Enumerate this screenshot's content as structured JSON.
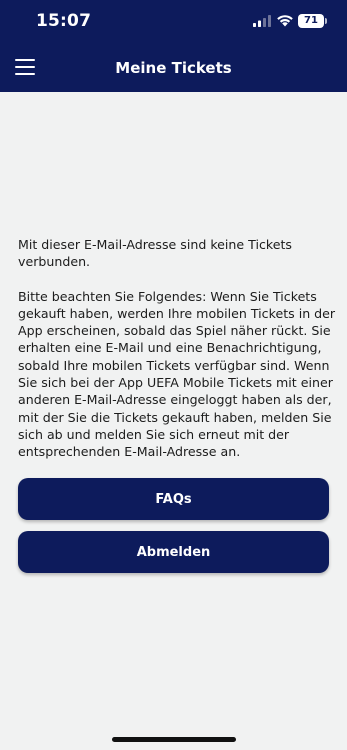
{
  "status_bar": {
    "time": "15:07",
    "battery_level": "71",
    "icons": [
      "signal-icon",
      "wifi-icon",
      "battery-icon"
    ]
  },
  "header": {
    "title": "Meine Tickets",
    "menu_icon": "hamburger-menu-icon"
  },
  "message": {
    "paragraph_1": "Mit dieser E-Mail-Adresse sind keine Tickets verbunden.",
    "paragraph_2": "Bitte beachten Sie Folgendes: Wenn Sie Tickets gekauft haben, werden Ihre mobilen Tickets in der App erscheinen, sobald das Spiel näher rückt. Sie erhalten eine E-Mail und eine Benachrichtigung, sobald Ihre mobilen Tickets verfügbar sind. Wenn Sie sich bei der App UEFA Mobile Tickets mit einer anderen E-Mail-Adresse eingeloggt haben als der, mit der Sie die Tickets gekauft haben, melden Sie sich ab und melden Sie sich erneut mit der entsprechenden E-Mail-Adresse an."
  },
  "actions": {
    "faq_label": "FAQs",
    "logout_label": "Abmelden"
  },
  "colors": {
    "header_background": "#0d1b5c",
    "button_background": "#0d1b5c",
    "page_background": "#f1f2f2",
    "text": "#1c1c1c"
  }
}
